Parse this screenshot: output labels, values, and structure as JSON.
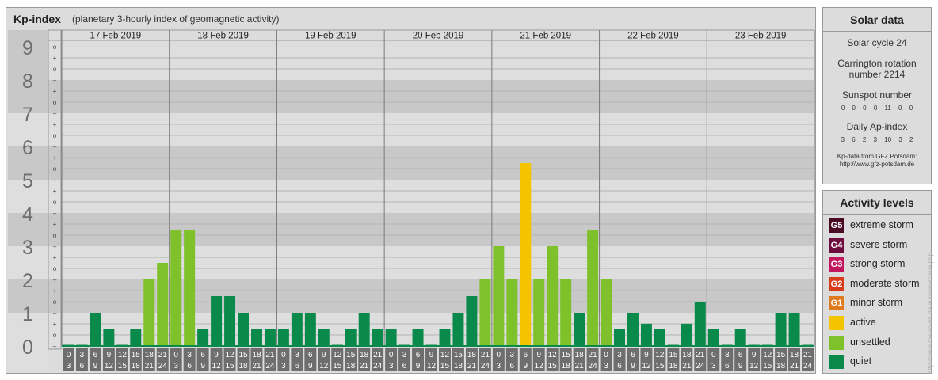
{
  "header": {
    "title": "Kp-index",
    "subtitle": "(planetary 3-hourly index of geomagnetic activity)"
  },
  "chart_data": {
    "type": "bar",
    "ylim": [
      0,
      9
    ],
    "y_ticks": [
      "0",
      "1",
      "2",
      "3",
      "4",
      "5",
      "6",
      "7",
      "8",
      "9"
    ],
    "sub_ticks": [
      "–",
      "o",
      "+"
    ],
    "days": [
      "17 Feb 2019",
      "18 Feb 2019",
      "19 Feb 2019",
      "20 Feb 2019",
      "21 Feb 2019",
      "22 Feb 2019",
      "23 Feb 2019"
    ],
    "hour_slots": [
      {
        "from": "0",
        "to": "3"
      },
      {
        "from": "3",
        "to": "6"
      },
      {
        "from": "6",
        "to": "9"
      },
      {
        "from": "9",
        "to": "12"
      },
      {
        "from": "12",
        "to": "15"
      },
      {
        "from": "15",
        "to": "18"
      },
      {
        "from": "18",
        "to": "21"
      },
      {
        "from": "21",
        "to": "24"
      }
    ],
    "values": [
      0.0,
      0.0,
      1.0,
      0.5,
      0.0,
      0.5,
      2.0,
      2.5,
      3.5,
      3.5,
      0.5,
      1.5,
      1.5,
      1.0,
      0.5,
      0.5,
      0.5,
      1.0,
      1.0,
      0.5,
      0.0,
      0.5,
      1.0,
      0.5,
      0.5,
      0.0,
      0.5,
      0.0,
      0.5,
      1.0,
      1.5,
      2.0,
      3.0,
      2.0,
      5.5,
      2.0,
      3.0,
      2.0,
      1.0,
      3.5,
      2.0,
      0.5,
      1.0,
      0.67,
      0.5,
      0.0,
      0.67,
      1.33,
      0.5,
      0.0,
      0.5,
      0.0,
      0.0,
      1.0,
      1.0,
      0.0
    ],
    "colors": {
      "quiet": "#0a8a4a",
      "unsettled": "#7ec12a",
      "active": "#f5c400"
    },
    "grid": true
  },
  "solar": {
    "title": "Solar data",
    "cycle": "Solar cycle 24",
    "carrington_line1": "Carrington rotation",
    "carrington_line2": "number 2214",
    "sunspot_label": "Sunspot number",
    "sunspot_values": "0 0 0 0 11 0 0",
    "ap_label": "Daily Ap-index",
    "ap_values": "3 6 2 3 10 3 2",
    "credit_line1": "Kp-data from GFZ Potsdam:",
    "credit_line2": "http://www.gfz-potsdam.de"
  },
  "activity": {
    "title": "Activity levels",
    "levels": [
      {
        "code": "G5",
        "label": "extreme storm",
        "color": "#4a0a24"
      },
      {
        "code": "G4",
        "label": "severe storm",
        "color": "#6e0c3e"
      },
      {
        "code": "G3",
        "label": "strong storm",
        "color": "#c2165e"
      },
      {
        "code": "G2",
        "label": "moderate storm",
        "color": "#d83c1c"
      },
      {
        "code": "G1",
        "label": "minor storm",
        "color": "#e07a1e"
      },
      {
        "code": "",
        "label": "active",
        "color": "#f5c400"
      },
      {
        "code": "",
        "label": "unsettled",
        "color": "#7ec12a"
      },
      {
        "code": "",
        "label": "quiet",
        "color": "#0a8a4a"
      }
    ]
  },
  "footer": {
    "url": "http://www.meteo-hh.de/aurora/archive.php"
  }
}
